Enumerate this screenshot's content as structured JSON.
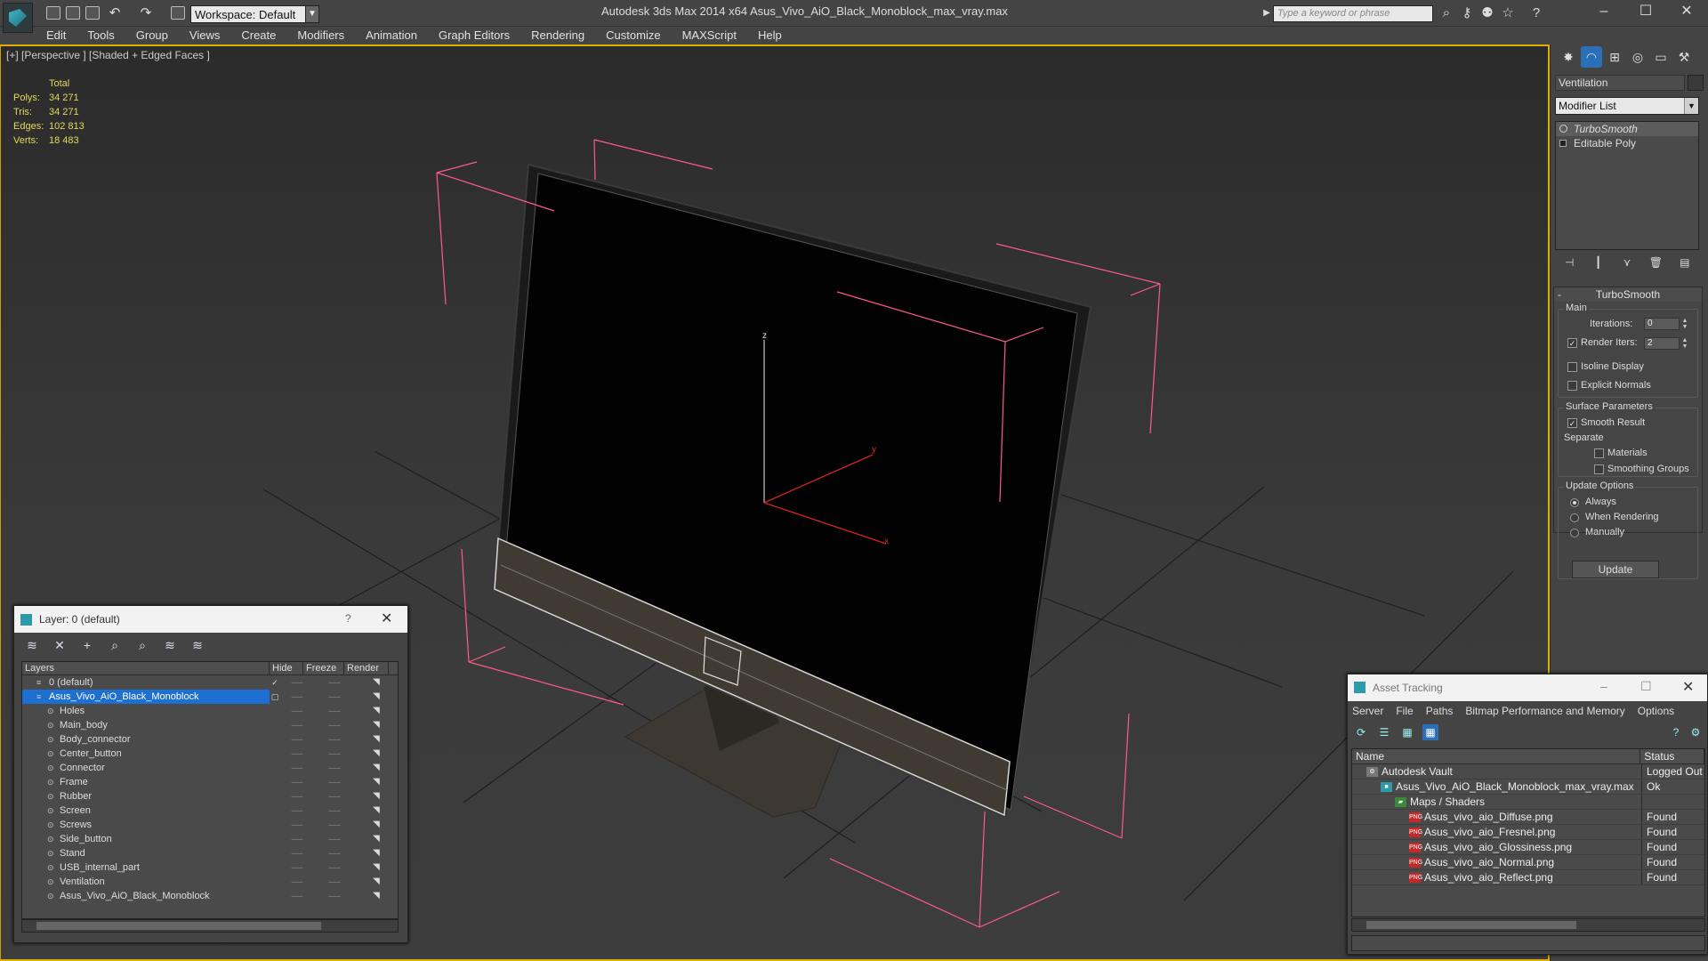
{
  "window": {
    "title": "Autodesk 3ds Max  2014 x64       Asus_Vivo_AiO_Black_Monoblock_max_vray.max",
    "workspace": "Workspace: Default",
    "search_placeholder": "Type a keyword or phrase"
  },
  "menu": [
    "Edit",
    "Tools",
    "Group",
    "Views",
    "Create",
    "Modifiers",
    "Animation",
    "Graph Editors",
    "Rendering",
    "Customize",
    "MAXScript",
    "Help"
  ],
  "viewport": {
    "label": "[+] [Perspective ] [Shaded + Edged Faces ]",
    "stats_header": "Total",
    "stats": [
      {
        "label": "Polys:",
        "value": "34 271"
      },
      {
        "label": "Tris:",
        "value": "34 271"
      },
      {
        "label": "Edges:",
        "value": "102 813"
      },
      {
        "label": "Verts:",
        "value": "18 483"
      }
    ],
    "axis_x": "x",
    "axis_y": "y",
    "axis_z": "z"
  },
  "command_panel": {
    "object_name": "Ventilation",
    "modifier_list": "Modifier List",
    "stack": [
      {
        "label": "TurboSmooth",
        "selected": true
      },
      {
        "label": "Editable Poly",
        "selected": false
      }
    ],
    "rollout_title": "TurboSmooth",
    "main_group": "Main",
    "iterations_label": "Iterations:",
    "iterations_value": "0",
    "render_iters_label": "Render Iters:",
    "render_iters_value": "2",
    "isoline_label": "Isoline Display",
    "explicit_normals_label": "Explicit Normals",
    "surface_group": "Surface Parameters",
    "smooth_result_label": "Smooth Result",
    "separate_label": "Separate",
    "materials_label": "Materials",
    "smoothing_groups_label": "Smoothing Groups",
    "update_group": "Update Options",
    "always_label": "Always",
    "when_rendering_label": "When Rendering",
    "manually_label": "Manually",
    "update_button": "Update"
  },
  "layer_dialog": {
    "title": "Layer: 0 (default)",
    "help": "?",
    "columns": [
      "Layers",
      "Hide",
      "Freeze",
      "Render"
    ],
    "rows": [
      {
        "name": "0 (default)",
        "level": 1,
        "selected": false
      },
      {
        "name": "Asus_Vivo_AiO_Black_Monoblock",
        "level": 1,
        "selected": true
      },
      {
        "name": "Holes",
        "level": 2,
        "selected": false
      },
      {
        "name": "Main_body",
        "level": 2,
        "selected": false
      },
      {
        "name": "Body_connector",
        "level": 2,
        "selected": false
      },
      {
        "name": "Center_button",
        "level": 2,
        "selected": false
      },
      {
        "name": "Connector",
        "level": 2,
        "selected": false
      },
      {
        "name": "Frame",
        "level": 2,
        "selected": false
      },
      {
        "name": "Rubber",
        "level": 2,
        "selected": false
      },
      {
        "name": "Screen",
        "level": 2,
        "selected": false
      },
      {
        "name": "Screws",
        "level": 2,
        "selected": false
      },
      {
        "name": "Side_button",
        "level": 2,
        "selected": false
      },
      {
        "name": "Stand",
        "level": 2,
        "selected": false
      },
      {
        "name": "USB_internal_part",
        "level": 2,
        "selected": false
      },
      {
        "name": "Ventilation",
        "level": 2,
        "selected": false
      },
      {
        "name": "Asus_Vivo_AiO_Black_Monoblock",
        "level": 2,
        "selected": false
      }
    ]
  },
  "asset_dialog": {
    "title": "Asset Tracking",
    "menu": [
      "Server",
      "File",
      "Paths",
      "Bitmap Performance and Memory",
      "Options"
    ],
    "columns": [
      "Name",
      "Status"
    ],
    "rows": [
      {
        "name": "Autodesk Vault",
        "status": "Logged Out",
        "level": 1,
        "icon": "vault-icon"
      },
      {
        "name": "Asus_Vivo_AiO_Black_Monoblock_max_vray.max",
        "status": "Ok",
        "level": 2,
        "icon": "max-file-icon"
      },
      {
        "name": "Maps / Shaders",
        "status": "",
        "level": 3,
        "icon": "maps-icon"
      },
      {
        "name": "Asus_vivo_aio_Diffuse.png",
        "status": "Found",
        "level": 4,
        "icon": "png-icon"
      },
      {
        "name": "Asus_vivo_aio_Fresnel.png",
        "status": "Found",
        "level": 4,
        "icon": "png-icon"
      },
      {
        "name": "Asus_vivo_aio_Glossiness.png",
        "status": "Found",
        "level": 4,
        "icon": "png-icon"
      },
      {
        "name": "Asus_vivo_aio_Normal.png",
        "status": "Found",
        "level": 4,
        "icon": "png-icon"
      },
      {
        "name": "Asus_vivo_aio_Reflect.png",
        "status": "Found",
        "level": 4,
        "icon": "png-icon"
      }
    ]
  },
  "colors": {
    "selection": "#1e6fd2",
    "viewport_border": "#e0b000",
    "stats_text": "#e6d85a",
    "bbox": "#ff5a8a"
  }
}
